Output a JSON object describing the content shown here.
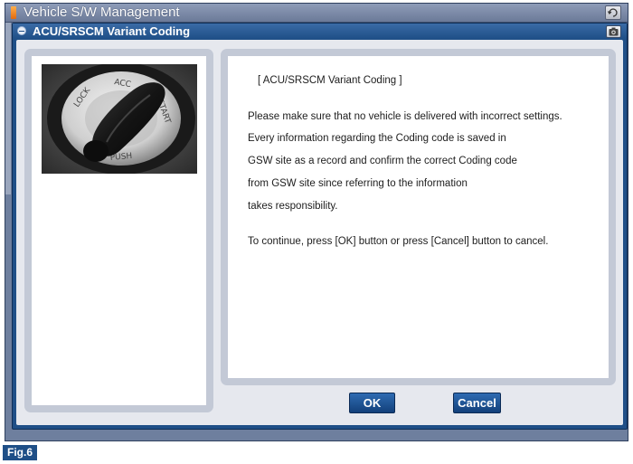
{
  "window": {
    "title": "Vehicle S/W Management",
    "retry_icon": "retry-icon"
  },
  "dialog": {
    "title": "ACU/SRSCM Variant Coding",
    "camera_icon": "camera-icon"
  },
  "image_panel": {
    "photo": "ignition-key-switch-photo",
    "labels": {
      "lock": "LOCK",
      "acc": "ACC",
      "start": "START",
      "push": "PUSH"
    }
  },
  "message": {
    "heading": "[ ACU/SRSCM Variant Coding ]",
    "lines": [
      "Please make sure that no vehicle is delivered with incorrect settings.",
      "Every information regarding the Coding code is saved in",
      "GSW site as a record and confirm the correct Coding code",
      "from GSW site since referring to the information",
      "takes responsibility.",
      "To continue, press [OK] button or press [Cancel] button to cancel."
    ]
  },
  "buttons": {
    "ok_label": "OK",
    "cancel_label": "Cancel"
  },
  "figure_label": "Fig.6",
  "colors": {
    "window_frame": "#6e7f9e",
    "dialog_frame": "#1f4f87",
    "button": "#1f5596",
    "panel_border": "#c3c9d6"
  }
}
